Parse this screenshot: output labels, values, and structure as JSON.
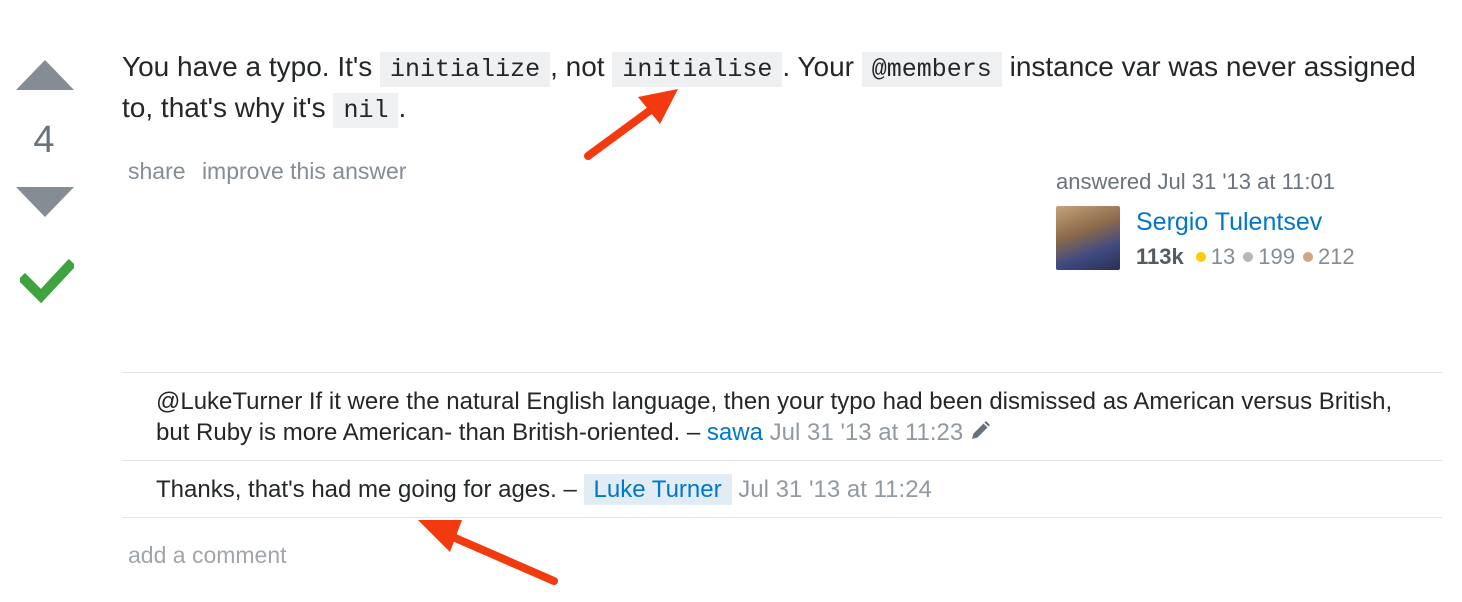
{
  "vote": {
    "count": "4"
  },
  "answer": {
    "t1": "You have a typo. It's ",
    "c1": "initialize",
    "t2": ", not ",
    "c2": "initialise",
    "t3": ". Your ",
    "c3": "@members",
    "t4": " instance var was never assigned to, that's why it's ",
    "c4": "nil",
    "t5": "."
  },
  "post_menu": {
    "share_label": "share",
    "improve_label": "improve this answer"
  },
  "signature": {
    "action_text": "answered Jul 31 '13 at 11:01",
    "user_name": "Sergio Tulentsev",
    "reputation": "113k",
    "gold_count": "13",
    "silver_count": "199",
    "bronze_count": "212"
  },
  "comments": [
    {
      "text": "@LukeTurner If it were the natural English language, then your typo had been dismissed as American versus British, but Ruby is more American- than British-oriented.",
      "separator": " – ",
      "user": "sawa",
      "date": "Jul 31 '13 at 11:23"
    },
    {
      "text": "Thanks, that's had me going for ages.",
      "separator": " – ",
      "user": "Luke Turner",
      "date": "Jul 31 '13 at 11:24"
    }
  ],
  "add_comment_label": "add a comment",
  "colors": {
    "link": "#0077cc",
    "accepted": "#3fa43f",
    "vote_arrow": "#858c93",
    "annotation": "#f33a0e",
    "code_bg": "#eff0f1",
    "op_highlight": "#e1ecf4"
  },
  "icons": {
    "vote_up": "triangle-up-icon",
    "vote_down": "triangle-down-icon",
    "accepted": "checkmark-icon",
    "edit": "pencil-icon"
  }
}
